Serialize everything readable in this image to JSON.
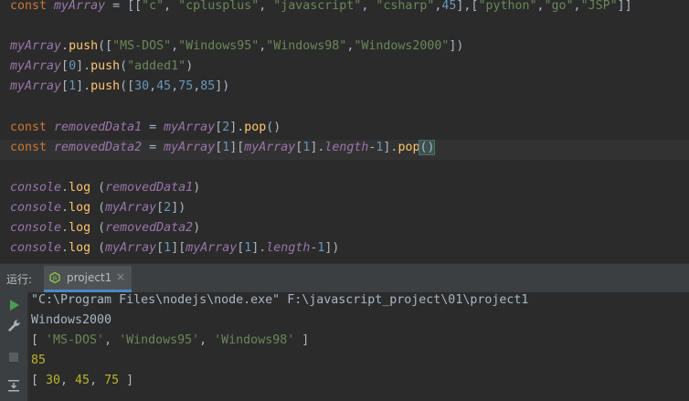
{
  "editor": {
    "lines": [
      {
        "segments": [
          {
            "c": "kw",
            "t": "const "
          },
          {
            "c": "var",
            "t": "myArray"
          },
          {
            "c": "pl",
            "t": " = [["
          },
          {
            "c": "str",
            "t": "\"c\""
          },
          {
            "c": "pl",
            "t": ", "
          },
          {
            "c": "str",
            "t": "\"cplusplus\""
          },
          {
            "c": "pl",
            "t": ", "
          },
          {
            "c": "str",
            "t": "\"javascript\""
          },
          {
            "c": "pl",
            "t": ", "
          },
          {
            "c": "str",
            "t": "\"csharp\""
          },
          {
            "c": "pl",
            "t": ","
          },
          {
            "c": "num",
            "t": "45"
          },
          {
            "c": "pl",
            "t": "],["
          },
          {
            "c": "str",
            "t": "\"python\""
          },
          {
            "c": "pl",
            "t": ","
          },
          {
            "c": "str",
            "t": "\"go\""
          },
          {
            "c": "pl",
            "t": ","
          },
          {
            "c": "str",
            "t": "\"JSP\""
          },
          {
            "c": "pl",
            "t": "]]"
          }
        ]
      },
      {
        "segments": []
      },
      {
        "segments": [
          {
            "c": "var",
            "t": "myArray"
          },
          {
            "c": "pl",
            "t": "."
          },
          {
            "c": "fnc",
            "t": "push"
          },
          {
            "c": "pl",
            "t": "(["
          },
          {
            "c": "str",
            "t": "\"MS-DOS\""
          },
          {
            "c": "pl",
            "t": ","
          },
          {
            "c": "str",
            "t": "\"Windows95\""
          },
          {
            "c": "pl",
            "t": ","
          },
          {
            "c": "str",
            "t": "\"Windows98\""
          },
          {
            "c": "pl",
            "t": ","
          },
          {
            "c": "str",
            "t": "\"Windows2000\""
          },
          {
            "c": "pl",
            "t": "])"
          }
        ]
      },
      {
        "segments": [
          {
            "c": "var",
            "t": "myArray"
          },
          {
            "c": "pl",
            "t": "["
          },
          {
            "c": "num",
            "t": "0"
          },
          {
            "c": "pl",
            "t": "]."
          },
          {
            "c": "fnc",
            "t": "push"
          },
          {
            "c": "pl",
            "t": "("
          },
          {
            "c": "str",
            "t": "\"added1\""
          },
          {
            "c": "pl",
            "t": ")"
          }
        ]
      },
      {
        "segments": [
          {
            "c": "var",
            "t": "myArray"
          },
          {
            "c": "pl",
            "t": "["
          },
          {
            "c": "num",
            "t": "1"
          },
          {
            "c": "pl",
            "t": "]."
          },
          {
            "c": "fnc",
            "t": "push"
          },
          {
            "c": "pl",
            "t": "(["
          },
          {
            "c": "num",
            "t": "30"
          },
          {
            "c": "pl",
            "t": ","
          },
          {
            "c": "num",
            "t": "45"
          },
          {
            "c": "pl",
            "t": ","
          },
          {
            "c": "num",
            "t": "75"
          },
          {
            "c": "pl",
            "t": ","
          },
          {
            "c": "num",
            "t": "85"
          },
          {
            "c": "pl",
            "t": "])"
          }
        ]
      },
      {
        "segments": []
      },
      {
        "segments": [
          {
            "c": "kw",
            "t": "const "
          },
          {
            "c": "var",
            "t": "removedData1"
          },
          {
            "c": "pl",
            "t": " = "
          },
          {
            "c": "var",
            "t": "myArray"
          },
          {
            "c": "pl",
            "t": "["
          },
          {
            "c": "num",
            "t": "2"
          },
          {
            "c": "pl",
            "t": "]."
          },
          {
            "c": "fnc",
            "t": "pop"
          },
          {
            "c": "pl",
            "t": "()"
          }
        ]
      },
      {
        "current": true,
        "segments": [
          {
            "c": "kw",
            "t": "const "
          },
          {
            "c": "var",
            "t": "removedData2"
          },
          {
            "c": "pl",
            "t": " = "
          },
          {
            "c": "var",
            "t": "myArray"
          },
          {
            "c": "pl",
            "t": "["
          },
          {
            "c": "num",
            "t": "1"
          },
          {
            "c": "pl",
            "t": "]["
          },
          {
            "c": "var",
            "t": "myArray"
          },
          {
            "c": "pl",
            "t": "["
          },
          {
            "c": "num",
            "t": "1"
          },
          {
            "c": "pl",
            "t": "]."
          },
          {
            "c": "var",
            "t": "length"
          },
          {
            "c": "pl",
            "t": "-"
          },
          {
            "c": "num",
            "t": "1"
          },
          {
            "c": "pl",
            "t": "]."
          },
          {
            "c": "fnc",
            "t": "pop"
          },
          {
            "c": "brace-match",
            "t": "()"
          }
        ]
      },
      {
        "segments": []
      },
      {
        "segments": [
          {
            "c": "var",
            "t": "console"
          },
          {
            "c": "pl",
            "t": "."
          },
          {
            "c": "fnc",
            "t": "log"
          },
          {
            "c": "pl",
            "t": " ("
          },
          {
            "c": "var",
            "t": "removedData1"
          },
          {
            "c": "pl",
            "t": ")"
          }
        ]
      },
      {
        "segments": [
          {
            "c": "var",
            "t": "console"
          },
          {
            "c": "pl",
            "t": "."
          },
          {
            "c": "fnc",
            "t": "log"
          },
          {
            "c": "pl",
            "t": " ("
          },
          {
            "c": "var",
            "t": "myArray"
          },
          {
            "c": "pl",
            "t": "["
          },
          {
            "c": "num",
            "t": "2"
          },
          {
            "c": "pl",
            "t": "])"
          }
        ]
      },
      {
        "segments": [
          {
            "c": "var",
            "t": "console"
          },
          {
            "c": "pl",
            "t": "."
          },
          {
            "c": "fnc",
            "t": "log"
          },
          {
            "c": "pl",
            "t": " ("
          },
          {
            "c": "var",
            "t": "removedData2"
          },
          {
            "c": "pl",
            "t": ")"
          }
        ]
      },
      {
        "segments": [
          {
            "c": "var",
            "t": "console"
          },
          {
            "c": "pl",
            "t": "."
          },
          {
            "c": "fnc",
            "t": "log"
          },
          {
            "c": "pl",
            "t": " ("
          },
          {
            "c": "var",
            "t": "myArray"
          },
          {
            "c": "pl",
            "t": "["
          },
          {
            "c": "num",
            "t": "1"
          },
          {
            "c": "pl",
            "t": "]["
          },
          {
            "c": "var",
            "t": "myArray"
          },
          {
            "c": "pl",
            "t": "["
          },
          {
            "c": "num",
            "t": "1"
          },
          {
            "c": "pl",
            "t": "]."
          },
          {
            "c": "var",
            "t": "length"
          },
          {
            "c": "pl",
            "t": "-"
          },
          {
            "c": "num",
            "t": "1"
          },
          {
            "c": "pl",
            "t": "])"
          }
        ]
      }
    ]
  },
  "run_panel": {
    "label": "运行:",
    "tab": {
      "label": "project1",
      "icon": "nodejs-icon",
      "close": "×"
    },
    "tools": [
      "run-icon",
      "wrench-icon",
      "stop-icon",
      "soft-wrap-icon"
    ]
  },
  "console": {
    "lines": [
      {
        "segments": [
          {
            "c": "pl",
            "t": "\"C:\\Program Files\\nodejs\\node.exe\" F:\\javascript_project\\01\\project1"
          }
        ]
      },
      {
        "segments": [
          {
            "c": "pl",
            "t": "Windows2000"
          }
        ]
      },
      {
        "segments": [
          {
            "c": "pl",
            "t": "[ "
          },
          {
            "c": "cstr",
            "t": "'MS-DOS'"
          },
          {
            "c": "pl",
            "t": ", "
          },
          {
            "c": "cstr",
            "t": "'Windows95'"
          },
          {
            "c": "pl",
            "t": ", "
          },
          {
            "c": "cstr",
            "t": "'Windows98'"
          },
          {
            "c": "pl",
            "t": " ]"
          }
        ]
      },
      {
        "segments": [
          {
            "c": "cnum",
            "t": "85"
          }
        ]
      },
      {
        "segments": [
          {
            "c": "pl",
            "t": "[ "
          },
          {
            "c": "cnum",
            "t": "30"
          },
          {
            "c": "pl",
            "t": ", "
          },
          {
            "c": "cnum",
            "t": "45"
          },
          {
            "c": "pl",
            "t": ", "
          },
          {
            "c": "cnum",
            "t": "75"
          },
          {
            "c": "pl",
            "t": " ]"
          }
        ]
      }
    ]
  }
}
